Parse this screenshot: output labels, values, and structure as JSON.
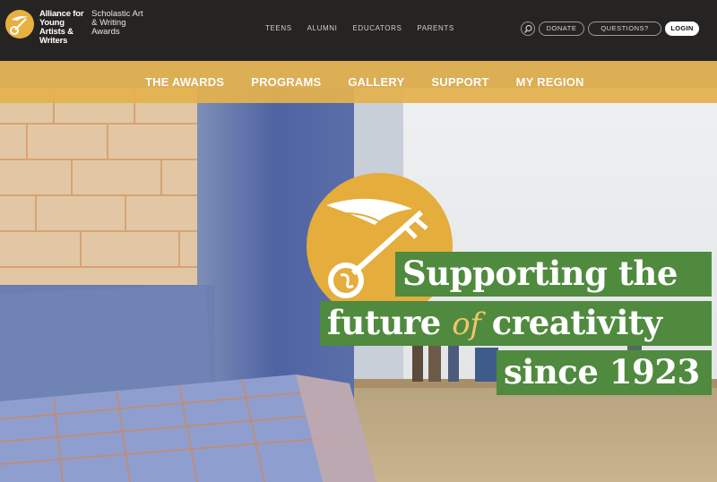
{
  "logo": {
    "primary": "Alliance for Young Artists & Writers",
    "secondary": "Scholastic Art & Writing Awards"
  },
  "top_nav": [
    "TEENS",
    "ALUMNI",
    "EDUCATORS",
    "PARENTS"
  ],
  "utility": {
    "donate": "DONATE",
    "questions": "QUESTIONS?",
    "login": "LOGIN"
  },
  "main_nav": [
    "THE AWARDS",
    "PROGRAMS",
    "GALLERY",
    "SUPPORT",
    "MY REGION"
  ],
  "hero": {
    "line1": "Supporting the",
    "line2_before": "future",
    "line2_of": "of",
    "line2_after": "creativity",
    "line3": "since 1923"
  },
  "colors": {
    "topbar_bg": "#262423",
    "accent_gold": "#e4b24e",
    "tag_green": "#4f8a3e"
  },
  "icons": [
    "winged-key-logo-icon",
    "search-icon",
    "winged-key-emblem-icon"
  ]
}
